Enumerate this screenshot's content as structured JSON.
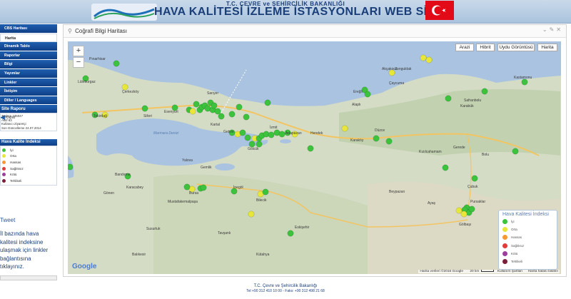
{
  "header": {
    "ministry": "T.C. ÇEVRE ve ŞEHİRCİLİK BAKANLIĞI",
    "title": "HAVA KALİTESİ İZLEME İSTASYONLARI WEB SİTESİ"
  },
  "sidebar": {
    "items": [
      {
        "label": "CBS Haritası"
      },
      {
        "label": "Harita"
      },
      {
        "label": "Dinamik Tablo"
      },
      {
        "label": "Raporlar"
      },
      {
        "label": "Bilgi"
      },
      {
        "label": "Yayımlar"
      },
      {
        "label": "Linkler"
      },
      {
        "label": "İletişim"
      },
      {
        "label": "Diller / Languages"
      },
      {
        "label": "Giriş"
      }
    ],
    "collapse_label": "Kapat",
    "site_report": {
      "title": "Site Raporu",
      "lines": [
        "Toplam 245047",
        "Aktif 83",
        "Kullanıcı Ziyaretçi",
        "Son Güncelleme 24.07.2014"
      ]
    },
    "aqi_panel": {
      "title": "Hava Kalite İndeksi",
      "levels": [
        {
          "label": "İyi",
          "color": "#3cc23c"
        },
        {
          "label": "Orta",
          "color": "#e7e63a"
        },
        {
          "label": "Hassas",
          "color": "#f59a33"
        },
        {
          "label": "Sağlıksız",
          "color": "#e13b3b"
        },
        {
          "label": "Kötü",
          "color": "#9b3f9e"
        },
        {
          "label": "Tehlikeli",
          "color": "#7a1f3a"
        }
      ]
    },
    "tweet": {
      "label": "Tweet",
      "text": "İl bazında hava kalitesi indeksine ulaşmak için linkler bağlantısına tıklayınız."
    }
  },
  "panel": {
    "title": "Coğrafi Bilgi Haritası"
  },
  "map": {
    "zoom_in": "+",
    "zoom_out": "−",
    "map_types": [
      "Arazi",
      "Hibrit",
      "Uydu Görüntüsü",
      "Harita"
    ],
    "google": "Google",
    "attribution": "Harita verileri ©2016 Google",
    "scale": "20 km",
    "terms": "Kullanım Şartları",
    "report": "Harita hatası bildirin",
    "places": [
      "Pınarhisar",
      "Lüleburgaz",
      "Çerkezköy",
      "Tekirdağ",
      "Silivri",
      "Esenyurt",
      "Sarıyer",
      "Kartal",
      "Gebze",
      "İzmit",
      "Adapazarı",
      "Hendek",
      "Gölcük",
      "Düzce",
      "Akçakoca",
      "Zonguldak",
      "Ereğli",
      "Alaplı",
      "Çaycuma",
      "Karabük",
      "Safranbolu",
      "Kastamonu",
      "Bolu",
      "Gerede",
      "Karaköy",
      "Bandırma",
      "Bursa",
      "İnegöl",
      "Bilecik",
      "Eskişehir",
      "Mustafakemalpaşa",
      "Karacabey",
      "Gönen",
      "Susurluk",
      "Balıkesir",
      "Kütahya",
      "Gemlik",
      "Yalova",
      "Beypazarı",
      "Ayaş",
      "Pursaklar",
      "Çubuk",
      "Gölbaşı",
      "Tavşanlı",
      "Kızılcahamam",
      "Marmara Denizi"
    ],
    "legend": {
      "title": "Hava Kalitesi İndeksi",
      "levels": [
        "İyi",
        "Orta",
        "Hassas",
        "Sağlıksız",
        "Kötü",
        "Tehlikeli"
      ],
      "colors": [
        "#3cc23c",
        "#e7e63a",
        "#f59a33",
        "#e13b3b",
        "#9b3f9e",
        "#7a1f3a"
      ]
    }
  },
  "footer": {
    "line1": "T.C. Çevre ve Şehircilik Bakanlığı",
    "line2": "Tel +90 312 410 10 00 - Faks: +90 312 498 21 68"
  }
}
